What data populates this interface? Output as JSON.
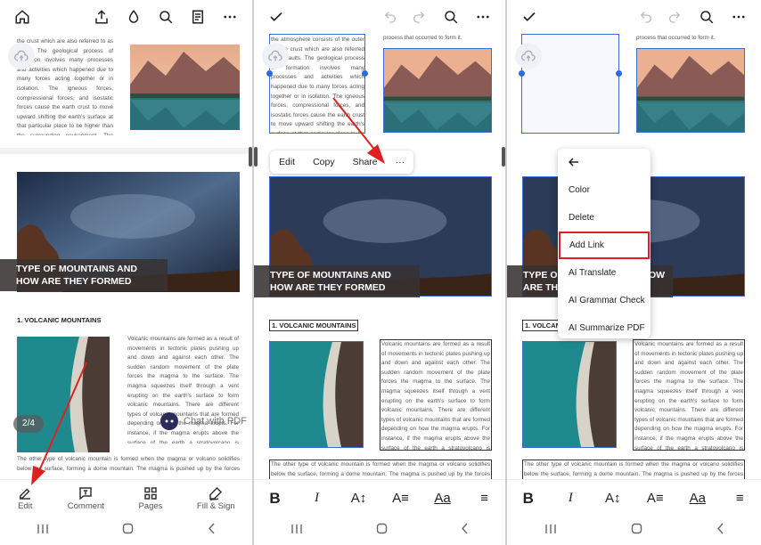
{
  "panel1": {
    "text_top": "the crust which are also referred to as faults. The geological process of formation involves many processes and activities which happened due to many forces acting together or in isolation. The igneous forces, compressional forces, and isostatic forces cause the earth crust to move upward shifting the earth's surface at that particular place to be higher than the surrounding environment. The resultant",
    "heading": "TYPE OF MOUNTAINS AND HOW ARE THEY FORMED",
    "subheading": "1. VOLCANIC MOUNTAINS",
    "body": "Volcanic mountains are formed as a result of movements in tectonic plates pushing up and down and against each other. The sudden random movement of the plate forces the magma to the surface. The magma squeezes itself through a vent erupting on the earth's surface to form volcanic mountains. There are different types of volcanic mountains that are formed depending on how the magma erupts. For instance, if the magma erupts above the surface of the earth a stratovolcano is formed. Examples of such mountains include Kilimanjaro, the Nyamuragira in DRC and Mount Fuji.",
    "bottom_text": "The other type of volcanic mountain is formed when the magma or volcano solidifies below the surface, forming a dome mountain. The magma is pushed up by the forces acting below it resulting in",
    "page_indicator": "2/4",
    "chat_label": "Chat with PDF",
    "tools": [
      "Edit",
      "Comment",
      "Pages",
      "Fill & Sign"
    ]
  },
  "panel2": {
    "text_top": "the atmosphere consists of the outer mantle crust which are also referred to as faults. The geological process of formation involves many processes and activities which happened due to many forces acting together or in isolation. The igneous forces, compressional forces, and isostatic forces cause the earth crust to move upward shifting the earth's surface at that particular place to be higher than the surrounding environment. The resultant",
    "text_top_right": "process that occurred to form it.",
    "context_menu": [
      "Edit",
      "Copy",
      "Share",
      "···"
    ],
    "heading": "TYPE OF MOUNTAINS AND HOW ARE THEY FORMED",
    "subheading": "1. VOLCANIC MOUNTAINS",
    "body": "Volcanic mountains are formed as a result of movements in tectonic plates pushing up and down and against each other. The sudden random movement of the plate forces the magma to the surface. The magma squeezes itself through a vent erupting on the earth's surface to form volcanic mountains. There are different types of volcanic mountains that are formed depending on how the magma erupts. For instance, if the magma erupts above the surface of the earth a stratovolcano is formed. Examples of such mountains include Kilimanjaro, the Nyamuragira in DRC and Mount Fuji.",
    "bottom_text": "The other type of volcanic mountain is formed when the magma or volcano solidifies below the surface, forming a dome mountain. The magma is pushed up by the forces acting below it resulting in"
  },
  "panel3": {
    "text_top_right": "process that occurred to form it.",
    "menu": [
      "Color",
      "Delete",
      "Add Link",
      "AI Translate",
      "AI Grammar Check",
      "AI Summarize PDF"
    ],
    "heading_partial_1": "TYPE OF",
    "heading_partial_2": "ARE THE",
    "heading_partial_3": "OW",
    "subheading": "1. VOLCANIC MOUNTAINS",
    "body": "Volcanic mountains are formed as a result of movements in tectonic plates pushing up and down and against each other. The sudden random movement of the plate forces the magma to the surface. The magma squeezes itself through a vent erupting on the earth's surface to form volcanic mountains. There are different types of volcanic mountains that are formed depending on how the magma erupts. For instance, if the magma erupts above the surface of the earth a stratovolcano is formed. Examples of such mountains include Kilimanjaro, the Nyamuragira in DRC and Mount Fuji.",
    "bottom_text": "The other type of volcanic mountain is formed when the magma or volcano solidifies below the surface, forming a dome mountain. The magma is pushed up by the forces acting below it resulting in"
  },
  "format_tools": [
    "B",
    "I",
    "A↕",
    "A≡",
    "Aa",
    "≡"
  ],
  "colors": {
    "accent_red": "#e02020",
    "selection_blue": "#2e6bdc",
    "heading_bg": "#3a3535"
  }
}
